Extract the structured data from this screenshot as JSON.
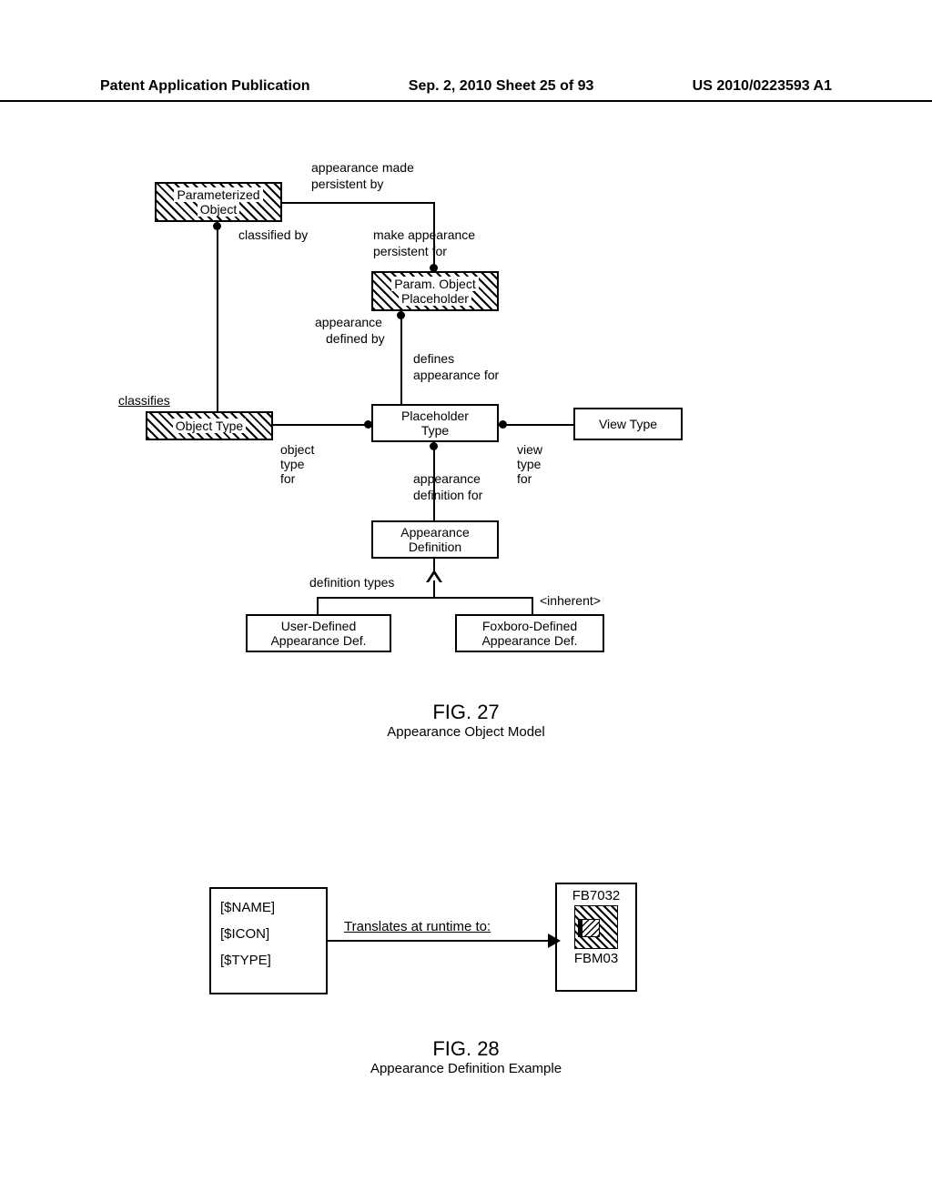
{
  "header": {
    "left": "Patent Application Publication",
    "center": "Sep. 2, 2010  Sheet 25 of 93",
    "right": "US 2010/0223593 A1"
  },
  "fig27": {
    "boxes": {
      "parameterized_object_l1": "Parameterized",
      "parameterized_object_l2": "Object",
      "param_obj_ph_l1": "Param. Object",
      "param_obj_ph_l2": "Placeholder",
      "object_type": "Object Type",
      "placeholder_type_l1": "Placeholder",
      "placeholder_type_l2": "Type",
      "view_type": "View Type",
      "appearance_def_l1": "Appearance",
      "appearance_def_l2": "Definition",
      "user_def_l1": "User-Defined",
      "user_def_l2": "Appearance Def.",
      "fox_def_l1": "Foxboro-Defined",
      "fox_def_l2": "Appearance Def.",
      "inherent": "<inherent>"
    },
    "labels": {
      "appearance_made": "appearance made",
      "persistent_by": "persistent by",
      "classified_by": "classified by",
      "make_appearance": "make appearance",
      "persistent_for": "persistent for",
      "appearance_defined_by_l1": "appearance",
      "appearance_defined_by_l2": "defined by",
      "defines": "defines",
      "appearance_for": "appearance for",
      "classifies": "classifies",
      "object": "object",
      "type": "type",
      "for": "for",
      "view": "view",
      "appearance": "appearance",
      "definition_for": "definition for",
      "definition_types": "definition types"
    },
    "caption_num": "FIG. 27",
    "caption_title": "Appearance Object Model"
  },
  "fig28": {
    "left_box": {
      "l1": "[$NAME]",
      "l2": "[$ICON]",
      "l3": "[$TYPE]"
    },
    "arrow_label": "Translates at runtime to:",
    "right_box": {
      "top": "FB7032",
      "bottom": "FBM03"
    },
    "caption_num": "FIG. 28",
    "caption_title": "Appearance Definition Example"
  }
}
